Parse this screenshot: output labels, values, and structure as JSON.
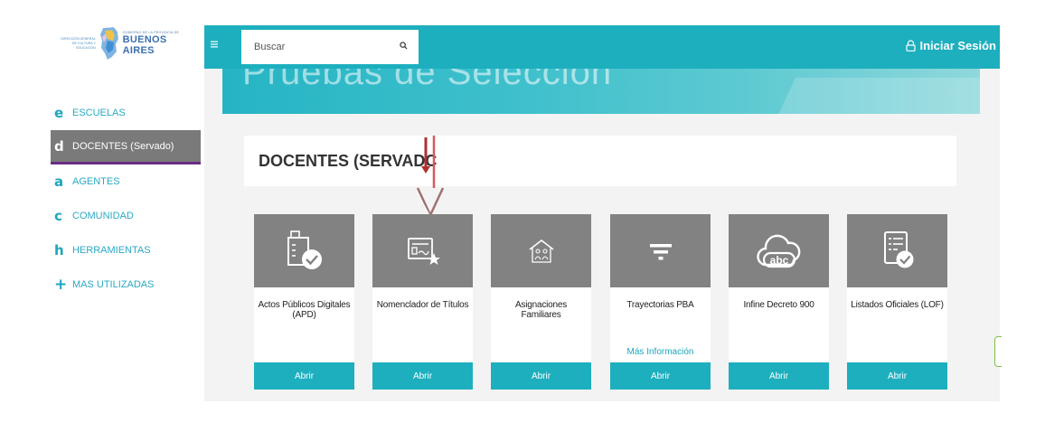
{
  "logo": {
    "left_text": "DIRECCIÓN GENERAL DE CULTURA Y EDUCACIÓN",
    "right_small": "GOBIERNO DE LA PROVINCIA DE",
    "right_big": "BUENOS AIRES"
  },
  "sidebar": {
    "items": [
      {
        "icon": "e",
        "label": "ESCUELAS"
      },
      {
        "icon": "d",
        "label": "DOCENTES (Servado)"
      },
      {
        "icon": "a",
        "label": "AGENTES"
      },
      {
        "icon": "c",
        "label": "COMUNIDAD"
      },
      {
        "icon": "h",
        "label": "HERRAMIENTAS"
      },
      {
        "icon": "+",
        "label": "MAS UTILIZADAS"
      }
    ],
    "active_index": 1
  },
  "topbar": {
    "menu_icon": "hamburger-icon",
    "search_placeholder": "Buscar",
    "search_icon": "search-icon",
    "login_label": "Iniciar Sesión",
    "login_icon": "lock-icon"
  },
  "banner": {
    "title": "Pruebas de Selección"
  },
  "section": {
    "title": "DOCENTES (SERVADC"
  },
  "cards": [
    {
      "title": "Actos Públicos Digitales (APD)",
      "icon": "document-check-icon",
      "button": "Abrir",
      "more": ""
    },
    {
      "title": "Nomenclador de Títulos",
      "icon": "certificate-icon",
      "button": "Abrir",
      "more": ""
    },
    {
      "title": "Asignaciones Familiares",
      "icon": "family-house-icon",
      "button": "Abrir",
      "more": ""
    },
    {
      "title": "Trayectorias PBA",
      "icon": "filter-icon",
      "button": "Abrir",
      "more": "Más Información"
    },
    {
      "title": "Infine Decreto 900",
      "icon": "abc-cloud-icon",
      "button": "Abrir",
      "more": ""
    },
    {
      "title": "Listados Oficiales (LOF)",
      "icon": "list-check-icon",
      "button": "Abrir",
      "more": ""
    }
  ],
  "colors": {
    "accent": "#1dafbe",
    "card_header": "#828282",
    "active_sidebar": "#7a7a7a",
    "active_underline": "#6b2d86",
    "arrow": "#b03030"
  }
}
